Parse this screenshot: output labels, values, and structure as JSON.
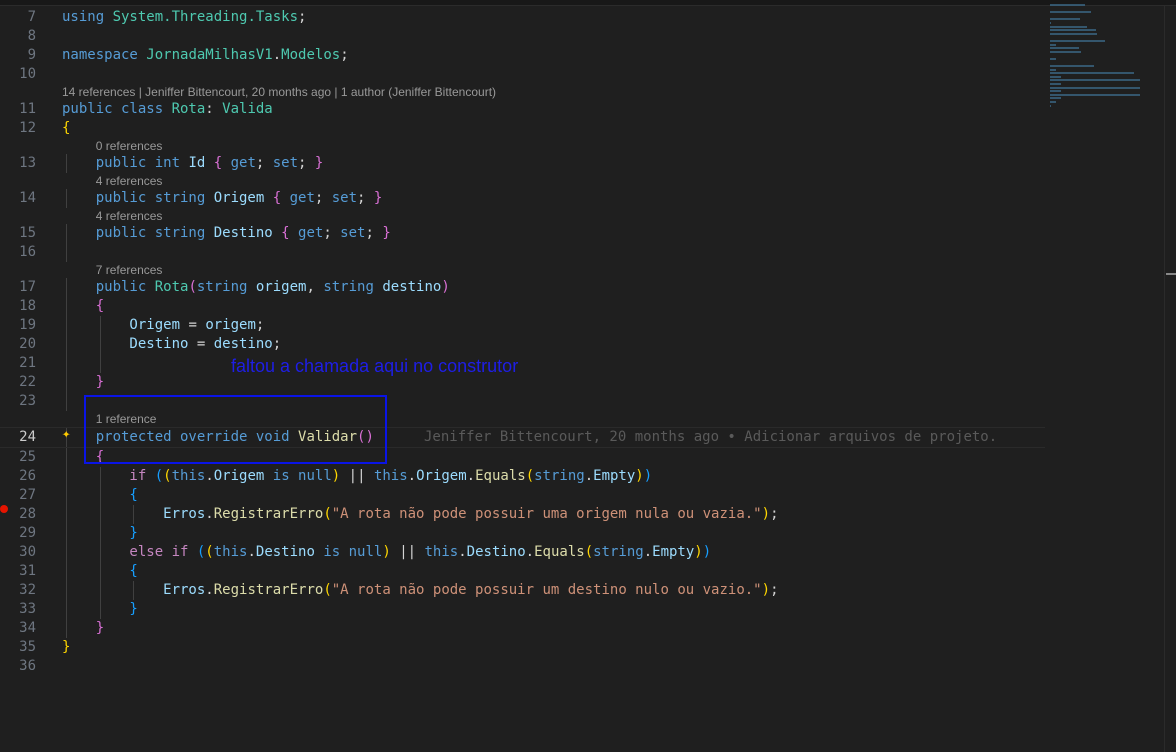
{
  "rows": [
    {
      "n": "7",
      "t": [
        [
          "using ",
          "kw"
        ],
        [
          "System.Threading.Tasks",
          "ns"
        ],
        [
          ";",
          "pl"
        ]
      ]
    },
    {
      "n": "8",
      "t": []
    },
    {
      "n": "9",
      "t": [
        [
          "namespace ",
          "kw"
        ],
        [
          "JornadaMilhasV1",
          "ns"
        ],
        [
          ".",
          "pl"
        ],
        [
          "Modelos",
          "ns"
        ],
        [
          ";",
          "pl"
        ]
      ]
    },
    {
      "n": "10",
      "t": []
    },
    {
      "lens": "14 references | Jeniffer Bittencourt, 20 months ago | 1 author (Jeniffer Bittencourt)",
      "indent": 0
    },
    {
      "n": "11",
      "t": [
        [
          "public class ",
          "kw"
        ],
        [
          "Rota",
          "cls"
        ],
        [
          ": ",
          "pl"
        ],
        [
          "Valida",
          "cls"
        ]
      ]
    },
    {
      "n": "12",
      "t": [
        [
          "{",
          "b1"
        ]
      ]
    },
    {
      "lens": "0 references",
      "indent": 4
    },
    {
      "n": "13",
      "t": [
        [
          "    public int ",
          "kw"
        ],
        [
          "Id ",
          "prop"
        ],
        [
          "{ ",
          "b2"
        ],
        [
          "get",
          "kw"
        ],
        [
          "; ",
          "pl"
        ],
        [
          "set",
          "kw"
        ],
        [
          "; ",
          "pl"
        ],
        [
          "}",
          "b2"
        ]
      ]
    },
    {
      "lens": "4 references",
      "indent": 4
    },
    {
      "n": "14",
      "t": [
        [
          "    public string ",
          "kw"
        ],
        [
          "Origem ",
          "prop"
        ],
        [
          "{ ",
          "b2"
        ],
        [
          "get",
          "kw"
        ],
        [
          "; ",
          "pl"
        ],
        [
          "set",
          "kw"
        ],
        [
          "; ",
          "pl"
        ],
        [
          "}",
          "b2"
        ]
      ]
    },
    {
      "lens": "4 references",
      "indent": 4
    },
    {
      "n": "15",
      "t": [
        [
          "    public string ",
          "kw"
        ],
        [
          "Destino ",
          "prop"
        ],
        [
          "{ ",
          "b2"
        ],
        [
          "get",
          "kw"
        ],
        [
          "; ",
          "pl"
        ],
        [
          "set",
          "kw"
        ],
        [
          "; ",
          "pl"
        ],
        [
          "}",
          "b2"
        ]
      ]
    },
    {
      "n": "16",
      "t": []
    },
    {
      "lens": "7 references",
      "indent": 4
    },
    {
      "n": "17",
      "t": [
        [
          "    public ",
          "kw"
        ],
        [
          "Rota",
          "cls"
        ],
        [
          "(",
          "b2"
        ],
        [
          "string ",
          "kw"
        ],
        [
          "origem",
          "id"
        ],
        [
          ", ",
          "pl"
        ],
        [
          "string ",
          "kw"
        ],
        [
          "destino",
          "id"
        ],
        [
          ")",
          "b2"
        ]
      ]
    },
    {
      "n": "18",
      "t": [
        [
          "    {",
          "b2"
        ]
      ]
    },
    {
      "n": "19",
      "t": [
        [
          "        Origem",
          "prop"
        ],
        [
          " = ",
          "pl"
        ],
        [
          "origem",
          "id"
        ],
        [
          ";",
          "pl"
        ]
      ]
    },
    {
      "n": "20",
      "t": [
        [
          "        Destino",
          "prop"
        ],
        [
          " = ",
          "pl"
        ],
        [
          "destino",
          "id"
        ],
        [
          ";",
          "pl"
        ]
      ]
    },
    {
      "n": "21",
      "t": []
    },
    {
      "n": "22",
      "t": [
        [
          "    }",
          "b2"
        ]
      ]
    },
    {
      "n": "23",
      "t": []
    },
    {
      "lens": "1 reference",
      "indent": 4
    },
    {
      "n": "24",
      "active": true,
      "t": [
        [
          "    protected override void ",
          "kw"
        ],
        [
          "Validar",
          "fn"
        ],
        [
          "()",
          "b2"
        ]
      ],
      "blame": "Jeniffer Bittencourt, 20 months ago • Adicionar arquivos de projeto."
    },
    {
      "n": "25",
      "t": [
        [
          "    {",
          "b2"
        ]
      ]
    },
    {
      "n": "26",
      "t": [
        [
          "        if ",
          "ctrl"
        ],
        [
          "(",
          "b3"
        ],
        [
          "(",
          "b1"
        ],
        [
          "this",
          "kw"
        ],
        [
          ".",
          "pl"
        ],
        [
          "Origem ",
          "prop"
        ],
        [
          "is null",
          "kw"
        ],
        [
          ")",
          "b1"
        ],
        [
          " || ",
          "pl"
        ],
        [
          "this",
          "kw"
        ],
        [
          ".",
          "pl"
        ],
        [
          "Origem",
          "prop"
        ],
        [
          ".",
          "pl"
        ],
        [
          "Equals",
          "fn"
        ],
        [
          "(",
          "b1"
        ],
        [
          "string",
          "kw"
        ],
        [
          ".",
          "pl"
        ],
        [
          "Empty",
          "prop"
        ],
        [
          ")",
          "b1"
        ],
        [
          ")",
          "b3"
        ]
      ]
    },
    {
      "n": "27",
      "t": [
        [
          "        {",
          "b3"
        ]
      ]
    },
    {
      "n": "28",
      "t": [
        [
          "            Erros",
          "prop"
        ],
        [
          ".",
          "pl"
        ],
        [
          "RegistrarErro",
          "fn"
        ],
        [
          "(",
          "b1"
        ],
        [
          "\"A rota não pode possuir uma origem nula ou vazia.\"",
          "str"
        ],
        [
          ")",
          "b1"
        ],
        [
          ";",
          "pl"
        ]
      ]
    },
    {
      "n": "29",
      "t": [
        [
          "        }",
          "b3"
        ]
      ]
    },
    {
      "n": "30",
      "t": [
        [
          "        else if ",
          "ctrl"
        ],
        [
          "(",
          "b3"
        ],
        [
          "(",
          "b1"
        ],
        [
          "this",
          "kw"
        ],
        [
          ".",
          "pl"
        ],
        [
          "Destino ",
          "prop"
        ],
        [
          "is null",
          "kw"
        ],
        [
          ")",
          "b1"
        ],
        [
          " || ",
          "pl"
        ],
        [
          "this",
          "kw"
        ],
        [
          ".",
          "pl"
        ],
        [
          "Destino",
          "prop"
        ],
        [
          ".",
          "pl"
        ],
        [
          "Equals",
          "fn"
        ],
        [
          "(",
          "b1"
        ],
        [
          "string",
          "kw"
        ],
        [
          ".",
          "pl"
        ],
        [
          "Empty",
          "prop"
        ],
        [
          ")",
          "b1"
        ],
        [
          ")",
          "b3"
        ]
      ]
    },
    {
      "n": "31",
      "t": [
        [
          "        {",
          "b3"
        ]
      ]
    },
    {
      "n": "32",
      "t": [
        [
          "            Erros",
          "prop"
        ],
        [
          ".",
          "pl"
        ],
        [
          "RegistrarErro",
          "fn"
        ],
        [
          "(",
          "b1"
        ],
        [
          "\"A rota não pode possuir um destino nulo ou vazio.\"",
          "str"
        ],
        [
          ")",
          "b1"
        ],
        [
          ";",
          "pl"
        ]
      ]
    },
    {
      "n": "33",
      "t": [
        [
          "        }",
          "b3"
        ]
      ]
    },
    {
      "n": "34",
      "t": [
        [
          "    }",
          "b2"
        ]
      ]
    },
    {
      "n": "35",
      "t": [
        [
          "}",
          "b1"
        ]
      ]
    },
    {
      "n": "36",
      "t": []
    }
  ],
  "annotation": "faltou a chamada aqui no construtor",
  "colors": {
    "annotation": "#1e1ee6",
    "breakpoint": "#e51400"
  }
}
